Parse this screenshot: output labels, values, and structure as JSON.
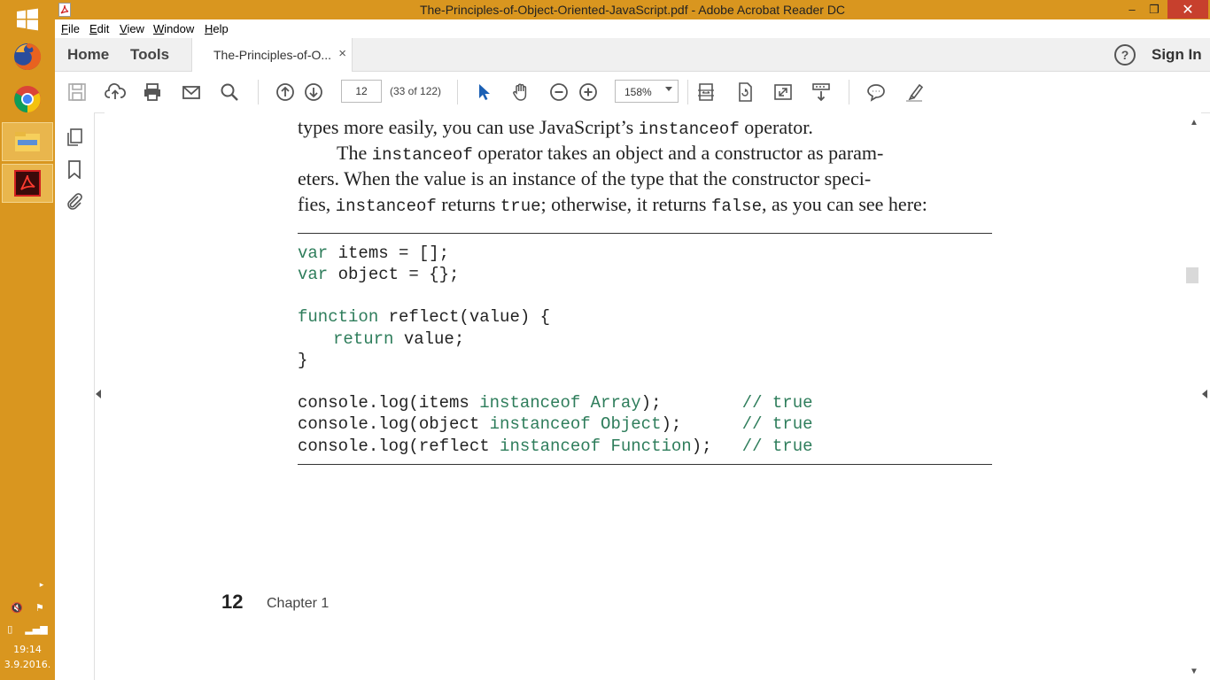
{
  "taskbar": {
    "apps": [
      {
        "name": "firefox-icon"
      },
      {
        "name": "chrome-icon"
      },
      {
        "name": "file-explorer-icon"
      },
      {
        "name": "acrobat-icon"
      }
    ],
    "clock_time": "19:14",
    "clock_date": "3.9.2016."
  },
  "window": {
    "title": "The-Principles-of-Object-Oriented-JavaScript.pdf - Adobe Acrobat Reader DC",
    "minimize": "–",
    "maximize": "❐",
    "close": "✕"
  },
  "menu": {
    "file": {
      "u": "F",
      "rest": "ile"
    },
    "edit": {
      "u": "E",
      "rest": "dit"
    },
    "view": {
      "u": "V",
      "rest": "iew"
    },
    "window": {
      "u": "W",
      "rest": "indow"
    },
    "help": {
      "u": "H",
      "rest": "elp"
    }
  },
  "tabs": {
    "home": "Home",
    "tools": "Tools",
    "document": "The-Principles-of-O...",
    "close": "×",
    "help": "?",
    "sign_in": "Sign In"
  },
  "toolbar": {
    "page_current": "12",
    "page_info": "(33 of 122)",
    "zoom": "158%"
  },
  "document": {
    "para1_line1_a": "types more easily, you can use JavaScript’s ",
    "para1_line1_code": "instanceof",
    "para1_line1_b": " operator.",
    "para2_line1_a": "The ",
    "para2_line1_code": "instanceof",
    "para2_line1_b": " operator takes an object and a constructor as param-",
    "para2_line2": "eters. When the value is an instance of the type that the constructor speci-",
    "para2_line3_a": "fies, ",
    "para2_line3_code1": "instanceof",
    "para2_line3_b": " returns ",
    "para2_line3_code2": "true",
    "para2_line3_c": "; otherwise, it returns ",
    "para2_line3_code3": "false",
    "para2_line3_d": ", as you can see here:",
    "code": {
      "l1_kw": "var",
      "l1_rest": " items = [];",
      "l2_kw": "var",
      "l2_rest": " object = {};",
      "l3_kw": "function",
      "l3_rest": " reflect(value) {",
      "l4_kw": "return",
      "l4_rest": " value;",
      "l5": "}",
      "l6_a": "console.log(items ",
      "l6_kw": "instanceof Array",
      "l6_b": ");        ",
      "l6_c": "// true",
      "l7_a": "console.log(object ",
      "l7_kw": "instanceof Object",
      "l7_b": ");      ",
      "l7_c": "// true",
      "l8_a": "console.log(reflect ",
      "l8_kw": "instanceof Function",
      "l8_b": ");   ",
      "l8_c": "// true"
    },
    "page_number": "12",
    "chapter": "Chapter 1"
  }
}
